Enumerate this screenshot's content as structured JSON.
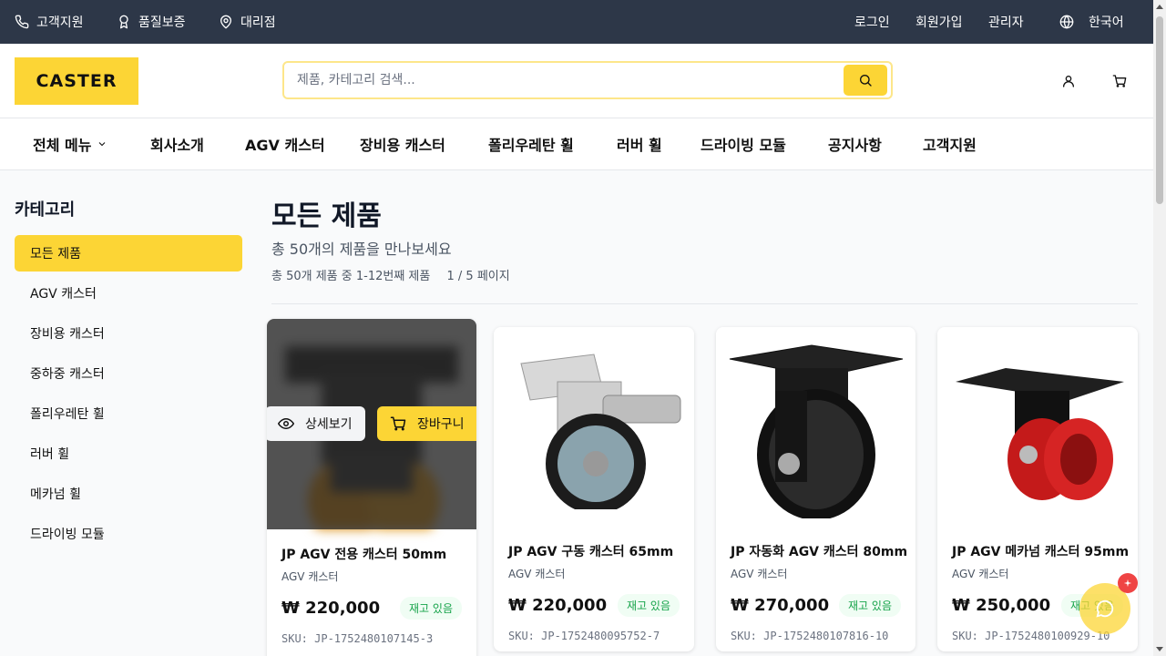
{
  "topbar": {
    "support": "고객지원",
    "quality": "품질보증",
    "dealer": "대리점",
    "login": "로그인",
    "signup": "회원가입",
    "admin": "관리자",
    "language": "한국어"
  },
  "header": {
    "logo": "CASTER",
    "search_placeholder": "제품, 카테고리 검색..."
  },
  "nav": {
    "items": [
      "전체 메뉴",
      "회사소개",
      "AGV 캐스터",
      "장비용 캐스터",
      "폴리우레탄 휠",
      "러버 휠",
      "드라이빙 모듈",
      "공지사항",
      "고객지원"
    ]
  },
  "sidebar": {
    "title": "카테고리",
    "items": [
      "모든 제품",
      "AGV 캐스터",
      "장비용 캐스터",
      "중하중 캐스터",
      "폴리우레탄 휠",
      "러버 휠",
      "메카넘 휠",
      "드라이빙 모듈"
    ]
  },
  "main": {
    "title": "모든 제품",
    "subtitle": "총 50개의 제품을 만나보세요",
    "count_text": "총 50개 제품 중 1-12번째 제품",
    "page_text": "1 / 5 페이지",
    "detail_label": "상세보기",
    "cart_label": "장바구니"
  },
  "products": [
    {
      "name": "JP AGV 전용 캐스터 50mm",
      "category": "AGV 캐스터",
      "price": "₩ 220,000",
      "stock": "재고 있음",
      "sku": "SKU: JP-1752480107145-3"
    },
    {
      "name": "JP AGV 구동 캐스터 65mm",
      "category": "AGV 캐스터",
      "price": "₩ 220,000",
      "stock": "재고 있음",
      "sku": "SKU: JP-1752480095752-7"
    },
    {
      "name": "JP 자동화 AGV 캐스터 80mm",
      "category": "AGV 캐스터",
      "price": "₩ 270,000",
      "stock": "재고 있음",
      "sku": "SKU: JP-1752480107816-10"
    },
    {
      "name": "JP AGV 메카넘 캐스터 95mm",
      "category": "AGV 캐스터",
      "price": "₩ 250,000",
      "stock": "재고 있음",
      "sku": "SKU: JP-1752480100929-10"
    }
  ],
  "colors": {
    "accent": "#fcd535",
    "topbar": "#2d3748",
    "stock_green": "#16a34a"
  }
}
